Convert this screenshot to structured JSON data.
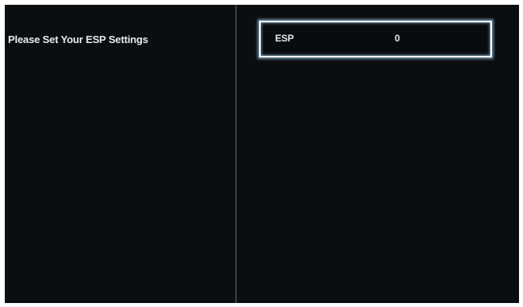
{
  "left_panel": {
    "prompt": "Please Set Your ESP Settings"
  },
  "right_panel": {
    "setting": {
      "label": "ESP",
      "value": "0"
    }
  },
  "colors": {
    "background": "#0a0d10",
    "text": "#e6e8ea",
    "divider": "#3b3f44",
    "focus_border": "#ffffff",
    "focus_glow": "#6c8ea7"
  }
}
